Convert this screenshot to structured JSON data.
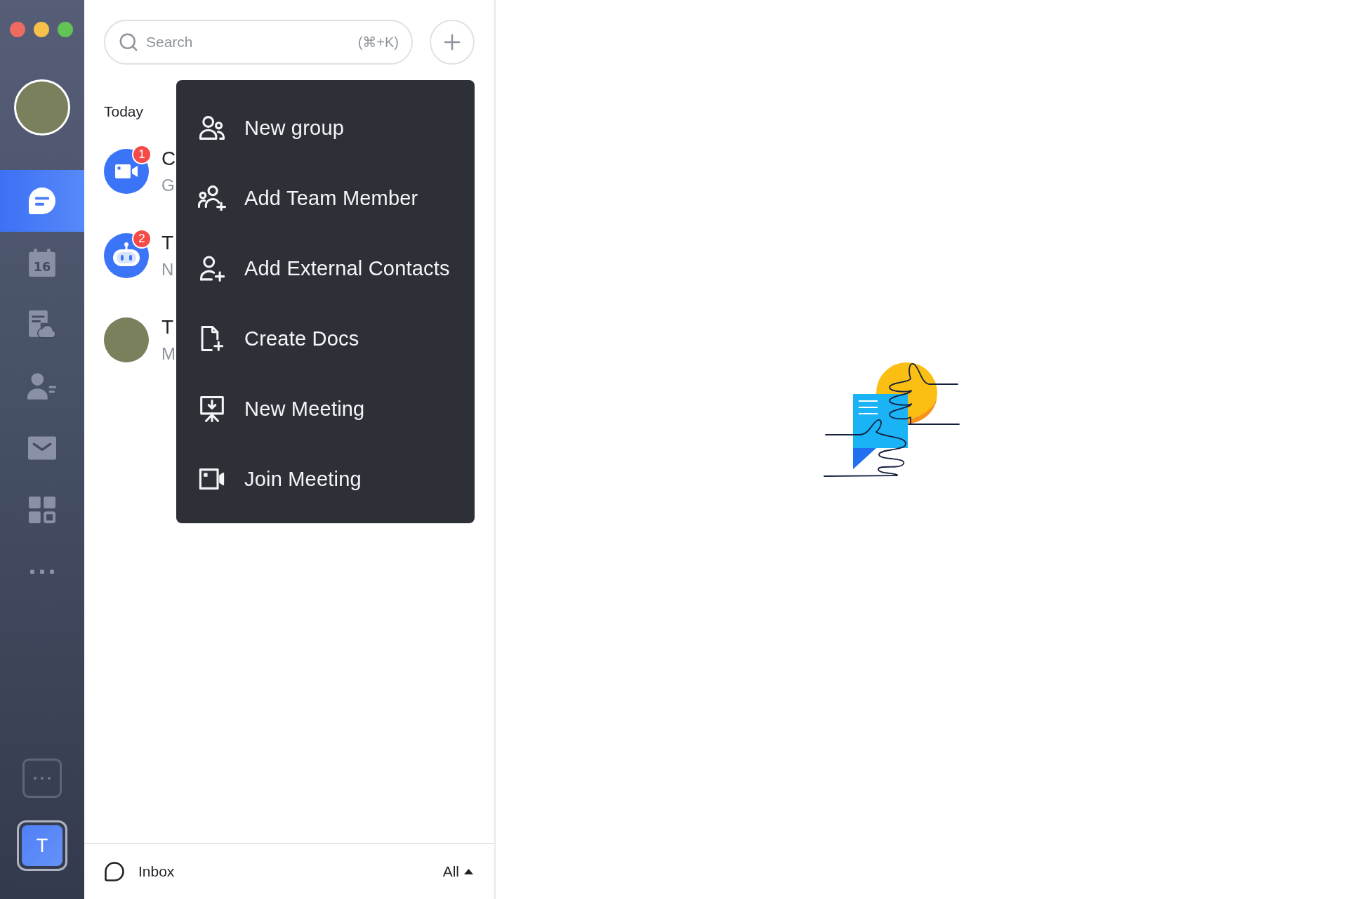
{
  "sidebar": {
    "nav_items": [
      {
        "kind": "messenger",
        "selected": true
      },
      {
        "kind": "calendar",
        "selected": false,
        "date": "16"
      },
      {
        "kind": "docs",
        "selected": false
      },
      {
        "kind": "contacts",
        "selected": false
      },
      {
        "kind": "mail",
        "selected": false
      },
      {
        "kind": "workplace",
        "selected": false
      },
      {
        "kind": "more",
        "selected": false
      }
    ],
    "teams": [
      {
        "initial": "T",
        "selected": true
      }
    ]
  },
  "chat_list": {
    "search": {
      "placeholder": "Search",
      "shortcut": "(⌘+K)"
    },
    "section_title": "Today",
    "conversations": [
      {
        "kind": "meeting",
        "badge": "1",
        "title": "C",
        "preview": "G"
      },
      {
        "kind": "bot",
        "badge": "2",
        "title": "T",
        "preview": "N"
      },
      {
        "kind": "photo",
        "title": "T",
        "preview": "M"
      }
    ]
  },
  "add_menu": {
    "items": [
      {
        "kind": "group",
        "label": "New group"
      },
      {
        "kind": "team_member",
        "label": "Add Team Member"
      },
      {
        "kind": "external_contact",
        "label": "Add External Contacts"
      },
      {
        "kind": "doc",
        "label": "Create Docs"
      },
      {
        "kind": "new_meeting",
        "label": "New Meeting"
      },
      {
        "kind": "join_meeting",
        "label": "Join Meeting"
      }
    ]
  },
  "footer": {
    "label": "Inbox",
    "filter": "All"
  }
}
